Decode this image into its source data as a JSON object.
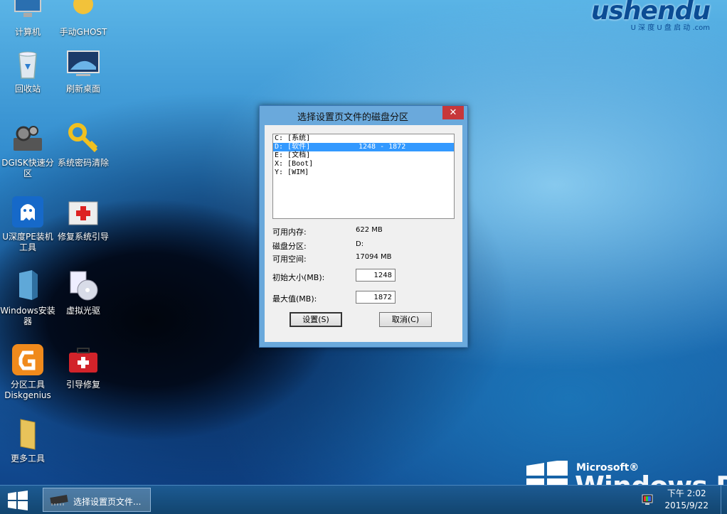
{
  "brand": {
    "logo": "ushendu",
    "logo_sub": "U 深 度 U 盘 启 动 .com"
  },
  "winpe": {
    "microsoft": "Microsoft®",
    "windows": "Windows PE"
  },
  "desktop_icons": [
    {
      "label": "计算机"
    },
    {
      "label": "手动GHOST"
    },
    {
      "label": "回收站"
    },
    {
      "label": "刷新桌面"
    },
    {
      "label": "DGISK快速分区"
    },
    {
      "label": "系统密码清除"
    },
    {
      "label": "U深度PE装机工具"
    },
    {
      "label": "修复系统引导"
    },
    {
      "label": "Windows安装器"
    },
    {
      "label": "虚拟光驱"
    },
    {
      "label": "分区工具Diskgenius"
    },
    {
      "label": "引导修复"
    },
    {
      "label": "更多工具"
    }
  ],
  "dialog": {
    "title": "选择设置页文件的磁盘分区",
    "close": "✕",
    "partitions": [
      {
        "name": "C: [系统]",
        "range": ""
      },
      {
        "name": "D: [软件]",
        "range": "1248 - 1872"
      },
      {
        "name": "E: [文档]",
        "range": ""
      },
      {
        "name": "X: [Boot]",
        "range": ""
      },
      {
        "name": "Y: [WIM]",
        "range": ""
      }
    ],
    "selected_index": 1,
    "info": {
      "mem_label": "可用内存:",
      "mem_value": "622 MB",
      "part_label": "磁盘分区:",
      "part_value": "D:",
      "space_label": "可用空间:",
      "space_value": "17094 MB"
    },
    "initial_label": "初始大小(MB):",
    "initial_value": "1248",
    "max_label": "最大值(MB):",
    "max_value": "1872",
    "ok_label": "设置(S)",
    "cancel_label": "取消(C)"
  },
  "taskbar": {
    "task_label": "选择设置页文件...",
    "clock_time": "下午 2:02",
    "clock_date": "2015/9/22"
  },
  "colors": {
    "accent": "#3399ff",
    "close": "#c7373a",
    "taskbar": "#1c5a92"
  }
}
